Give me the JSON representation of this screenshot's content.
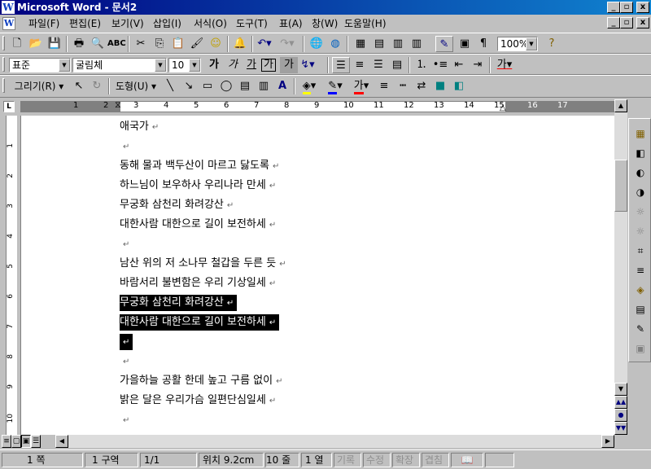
{
  "window": {
    "title": "Microsoft Word - 문서2",
    "app_icon": "W",
    "minimize": "_",
    "maximize": "▫",
    "close": "x"
  },
  "menu": [
    "파일(F)",
    "편집(E)",
    "보기(V)",
    "삽입(I)",
    "서식(O)",
    "도구(T)",
    "표(A)",
    "창(W)",
    "도움말(H)"
  ],
  "standard": {
    "zoom": "100%"
  },
  "formatting": {
    "style": "표준",
    "font": "굴림체",
    "size": "10",
    "bold": "가",
    "italic": "가",
    "underline": "가",
    "border": "가",
    "shade": "가",
    "phonetic": "가",
    "fontcolor": "가"
  },
  "drawing": {
    "draw": "그리기(R) ▾",
    "autoshape": "도형(U) ▾",
    "font_color": "가"
  },
  "ruler": {
    "numbers": [
      "1",
      "2",
      "3",
      "4",
      "5",
      "6",
      "7",
      "8",
      "9",
      "10",
      "11",
      "12",
      "13",
      "14",
      "15",
      "16",
      "17"
    ],
    "vnumbers": [
      "1",
      "2",
      "3",
      "4",
      "5",
      "6",
      "7",
      "8",
      "9",
      "10"
    ]
  },
  "document": {
    "lines": [
      {
        "text": "애국가",
        "sel": false
      },
      {
        "text": "",
        "sel": false
      },
      {
        "text": "동해 물과 백두산이 마르고 닳도록",
        "sel": false
      },
      {
        "text": "하느님이 보우하사 우리나라 만세",
        "sel": false
      },
      {
        "text": "무궁화 삼천리 화려강산",
        "sel": false
      },
      {
        "text": "대한사람 대한으로 길이 보전하세",
        "sel": false
      },
      {
        "text": "",
        "sel": false
      },
      {
        "text": "남산 위의 저 소나무 철갑을 두른 듯",
        "sel": false
      },
      {
        "text": "바람서리 불변함은 우리 기상일세",
        "sel": false
      },
      {
        "text": "무궁화 삼천리 화려강산",
        "sel": true
      },
      {
        "text": "대한사람 대한으로 길이 보전하세",
        "sel": true
      },
      {
        "text": "",
        "sel": true
      },
      {
        "text": "",
        "sel": false
      },
      {
        "text": "가을하늘 공활 한데 높고 구름 없이",
        "sel": false
      },
      {
        "text": "밝은 달은 우리가슴 일편단심일세",
        "sel": false
      },
      {
        "text": "",
        "sel": false
      }
    ],
    "para_mark": "↵"
  },
  "status": {
    "page": "1 쪽",
    "section": "1 구역",
    "pages": "1/1",
    "position": "위치 9.2cm",
    "line": "10 줄",
    "col": "1 열",
    "rec": "기록",
    "trk": "수정",
    "ext": "확장",
    "ovr": "겹침"
  },
  "colors": {
    "titlebar": "#000080",
    "selection": "#000000",
    "face": "#c0c0c0"
  }
}
